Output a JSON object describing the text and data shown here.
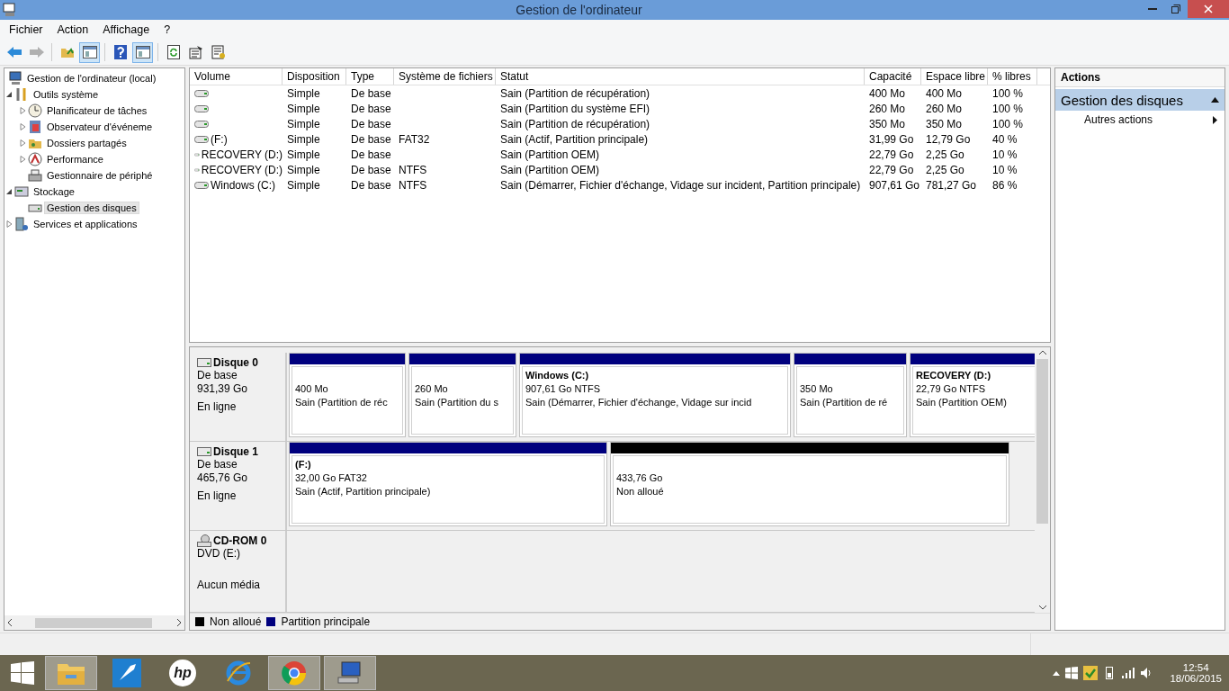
{
  "window": {
    "title": "Gestion de l'ordinateur"
  },
  "menu": [
    "Fichier",
    "Action",
    "Affichage",
    "?"
  ],
  "toolbar": [
    {
      "kind": "back",
      "disabled": false,
      "pressed": false
    },
    {
      "kind": "forward",
      "disabled": true,
      "pressed": false
    },
    {
      "kind": "up",
      "disabled": false,
      "pressed": false
    },
    {
      "kind": "pane",
      "disabled": false,
      "pressed": true
    },
    {
      "kind": "help",
      "disabled": false,
      "pressed": false
    },
    {
      "kind": "pane",
      "disabled": false,
      "pressed": true
    },
    {
      "kind": "refresh",
      "disabled": false,
      "pressed": false
    },
    {
      "kind": "properties",
      "disabled": false,
      "pressed": false
    },
    {
      "kind": "export",
      "disabled": false,
      "pressed": false
    }
  ],
  "tree": [
    {
      "label": "Gestion de l'ordinateur (local)",
      "kind": "computer",
      "selected": false,
      "children": [
        {
          "label": "Outils système",
          "kind": "tools",
          "expanded": true,
          "selected": false,
          "children": [
            {
              "label": "Planificateur de tâches",
              "kind": "clock",
              "expanded": false,
              "selected": false
            },
            {
              "label": "Observateur d'événeme",
              "kind": "log",
              "expanded": false,
              "selected": false
            },
            {
              "label": "Dossiers partagés",
              "kind": "share",
              "expanded": false,
              "selected": false
            },
            {
              "label": "Performance",
              "kind": "perf",
              "expanded": false,
              "selected": false
            },
            {
              "label": "Gestionnaire de périphé",
              "kind": "device",
              "selected": false
            }
          ]
        },
        {
          "label": "Stockage",
          "kind": "storage",
          "expanded": true,
          "selected": false,
          "children": [
            {
              "label": "Gestion des disques",
              "kind": "disk",
              "selected": true
            }
          ]
        },
        {
          "label": "Services et applications",
          "kind": "services",
          "expanded": false,
          "selected": false
        }
      ]
    }
  ],
  "table": {
    "columns": [
      "Volume",
      "Disposition",
      "Type",
      "Système de fichiers",
      "Statut",
      "Capacité",
      "Espace libre",
      "% libres"
    ],
    "rows": [
      {
        "disposition": "Simple",
        "type": "De base",
        "status": "Sain (Partition de récupération)",
        "capacity": "400 Mo",
        "free": "400 Mo",
        "percent": "100 %"
      },
      {
        "disposition": "Simple",
        "type": "De base",
        "status": "Sain (Partition du système EFI)",
        "capacity": "260 Mo",
        "free": "260 Mo",
        "percent": "100 %"
      },
      {
        "disposition": "Simple",
        "type": "De base",
        "status": "Sain (Partition de récupération)",
        "capacity": "350 Mo",
        "free": "350 Mo",
        "percent": "100 %"
      },
      {
        "volume": "(F:)",
        "disposition": "Simple",
        "type": "De base",
        "filesystem": "FAT32",
        "status": "Sain (Actif, Partition principale)",
        "capacity": "31,99 Go",
        "free": "12,79 Go",
        "percent": "40 %"
      },
      {
        "volume": "RECOVERY (D:)",
        "disposition": "Simple",
        "type": "De base",
        "status": "Sain (Partition OEM)",
        "capacity": "22,79 Go",
        "free": "2,25 Go",
        "percent": "10 %"
      },
      {
        "volume": "RECOVERY (D:)",
        "disposition": "Simple",
        "type": "De base",
        "filesystem": "NTFS",
        "status": "Sain (Partition OEM)",
        "capacity": "22,79 Go",
        "free": "2,25 Go",
        "percent": "10 %"
      },
      {
        "volume": "Windows (C:)",
        "disposition": "Simple",
        "type": "De base",
        "filesystem": "NTFS",
        "status": "Sain (Démarrer, Fichier d'échange, Vidage sur incident, Partition principale)",
        "capacity": "907,61 Go",
        "free": "781,27 Go",
        "percent": "86 %"
      }
    ]
  },
  "disks": [
    {
      "name": "Disque 0",
      "kind": "disk",
      "lines": [
        "De base",
        "931,39 Go"
      ],
      "status": "En ligne",
      "partitions": [
        {
          "kind": "primary",
          "size": "400 Mo",
          "status": "Sain (Partition de réc"
        },
        {
          "kind": "primary",
          "size": "260 Mo",
          "status": "Sain (Partition du s"
        },
        {
          "kind": "primary",
          "title": "Windows  (C:)",
          "size": "907,61 Go NTFS",
          "status": "Sain (Démarrer, Fichier d'échange, Vidage sur incid"
        },
        {
          "kind": "primary",
          "size": "350 Mo",
          "status": "Sain (Partition de ré"
        },
        {
          "kind": "primary",
          "title": "RECOVERY  (D:)",
          "size": "22,79 Go NTFS",
          "status": "Sain (Partition OEM)"
        }
      ]
    },
    {
      "name": "Disque 1",
      "kind": "disk",
      "lines": [
        "De base",
        "465,76 Go"
      ],
      "status": "En ligne",
      "partitions": [
        {
          "kind": "primary",
          "title": "(F:)",
          "size": "32,00 Go FAT32",
          "status": "Sain (Actif, Partition principale)"
        },
        {
          "kind": "unallocated",
          "size": "433,76 Go",
          "status": "Non alloué"
        }
      ]
    },
    {
      "name": "CD-ROM 0",
      "kind": "cdrom",
      "lines": [
        "DVD (E:)"
      ],
      "status": "Aucun média"
    }
  ],
  "legend": [
    {
      "kind": "unallocated",
      "label": "Non alloué"
    },
    {
      "kind": "primary",
      "label": "Partition principale"
    }
  ],
  "actions": {
    "header": "Actions",
    "section": {
      "label": "Gestion des disques",
      "expanded": true,
      "items": [
        "Autres actions"
      ]
    }
  },
  "taskbar": {
    "apps": [
      {
        "kind": "folder",
        "running": true
      },
      {
        "kind": "rocket",
        "running": false
      },
      {
        "kind": "hp",
        "running": false,
        "logo_text": "hp"
      },
      {
        "kind": "browser-e",
        "running": false
      },
      {
        "kind": "browser-ring",
        "running": true
      },
      {
        "kind": "computer",
        "running": true
      }
    ],
    "time": "12:54",
    "date": "18/06/2015"
  }
}
